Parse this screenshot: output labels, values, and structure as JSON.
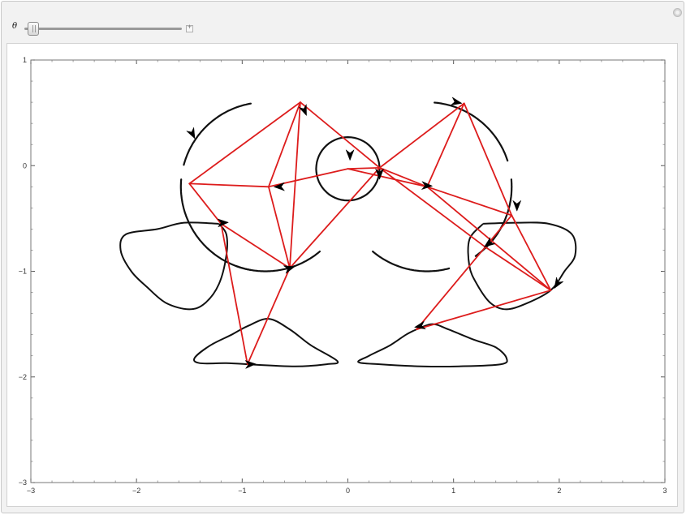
{
  "controls": {
    "parameter_label": "θ",
    "slider_value_fraction": 0.02
  },
  "chart_data": {
    "type": "line",
    "xlim": [
      -3,
      3
    ],
    "ylim": [
      -3,
      1
    ],
    "x_tick_labels": [
      "−3",
      "−2",
      "−1",
      "0",
      "1",
      "2",
      "3"
    ],
    "x_ticks": [
      -3,
      -2,
      -1,
      0,
      1,
      2,
      3
    ],
    "y_tick_labels": [
      "1",
      "0",
      "−1",
      "−2",
      "−3"
    ],
    "y_ticks": [
      1,
      0,
      -1,
      -2,
      -3
    ],
    "grid": false,
    "colors": {
      "curves": "#111111",
      "links": "#dd1c1c",
      "frame": "#777777"
    },
    "points": [
      {
        "id": "C",
        "x": 0.0,
        "y": -0.03
      },
      {
        "id": "C2",
        "x": 0.3,
        "y": -0.02
      },
      {
        "id": "L1",
        "x": -1.5,
        "y": -0.17
      },
      {
        "id": "L2",
        "x": -0.45,
        "y": 0.6
      },
      {
        "id": "L3",
        "x": -0.75,
        "y": -0.2
      },
      {
        "id": "L4",
        "x": -1.2,
        "y": -0.55
      },
      {
        "id": "L5",
        "x": -0.55,
        "y": -0.97
      },
      {
        "id": "L6",
        "x": -0.95,
        "y": -1.88
      },
      {
        "id": "R1",
        "x": 1.1,
        "y": 0.59
      },
      {
        "id": "R2",
        "x": 0.75,
        "y": -0.2
      },
      {
        "id": "R3",
        "x": 1.55,
        "y": -0.47
      },
      {
        "id": "R4",
        "x": 1.3,
        "y": -0.77
      },
      {
        "id": "R5",
        "x": 1.92,
        "y": -1.18
      },
      {
        "id": "R6",
        "x": 0.65,
        "y": -1.55
      }
    ],
    "links": [
      [
        "L1",
        "L2"
      ],
      [
        "L1",
        "L3"
      ],
      [
        "L1",
        "L4"
      ],
      [
        "L2",
        "L3"
      ],
      [
        "L2",
        "L5"
      ],
      [
        "L2",
        "C2"
      ],
      [
        "L3",
        "L5"
      ],
      [
        "L3",
        "C"
      ],
      [
        "L4",
        "L5"
      ],
      [
        "L4",
        "L6"
      ],
      [
        "L5",
        "L6"
      ],
      [
        "L5",
        "C2"
      ],
      [
        "C",
        "C2"
      ],
      [
        "C",
        "R2"
      ],
      [
        "C2",
        "R1"
      ],
      [
        "C2",
        "R2"
      ],
      [
        "C2",
        "R4"
      ],
      [
        "R1",
        "R2"
      ],
      [
        "R1",
        "R3"
      ],
      [
        "R2",
        "R3"
      ],
      [
        "R2",
        "R5"
      ],
      [
        "R3",
        "R4"
      ],
      [
        "R3",
        "R5"
      ],
      [
        "R4",
        "R5"
      ],
      [
        "R4",
        "R6"
      ],
      [
        "R5",
        "R6"
      ]
    ],
    "arcs": [
      {
        "cx": -0.78,
        "cy": -0.2,
        "r": 0.8,
        "from": 100,
        "to": 165
      },
      {
        "cx": -0.78,
        "cy": -0.2,
        "r": 0.8,
        "from": 175,
        "to": 260
      },
      {
        "cx": -0.78,
        "cy": -0.2,
        "r": 0.8,
        "from": 250,
        "to": 310
      },
      {
        "cx": 0.75,
        "cy": -0.2,
        "r": 0.8,
        "from": 18,
        "to": 85
      },
      {
        "cx": 0.75,
        "cy": -0.2,
        "r": 0.8,
        "from": -55,
        "to": 5
      },
      {
        "cx": 0.75,
        "cy": -0.2,
        "r": 0.8,
        "from": 230,
        "to": 285
      },
      {
        "cx": 0.0,
        "cy": -0.03,
        "r": 0.3,
        "from": 0,
        "to": 360
      }
    ],
    "closed_curves": [
      [
        [
          -1.22,
          -0.55
        ],
        [
          -1.55,
          -0.54
        ],
        [
          -1.8,
          -0.6
        ],
        [
          -2.1,
          -0.65
        ],
        [
          -2.15,
          -0.8
        ],
        [
          -2.05,
          -1.0
        ],
        [
          -1.9,
          -1.15
        ],
        [
          -1.72,
          -1.3
        ],
        [
          -1.5,
          -1.36
        ],
        [
          -1.35,
          -1.3
        ],
        [
          -1.22,
          -1.12
        ],
        [
          -1.15,
          -0.85
        ],
        [
          -1.15,
          -0.65
        ],
        [
          -1.22,
          -0.55
        ]
      ],
      [
        [
          1.28,
          -0.55
        ],
        [
          1.6,
          -0.54
        ],
        [
          1.9,
          -0.55
        ],
        [
          2.12,
          -0.65
        ],
        [
          2.15,
          -0.85
        ],
        [
          2.05,
          -1.0
        ],
        [
          1.92,
          -1.18
        ],
        [
          1.7,
          -1.3
        ],
        [
          1.5,
          -1.36
        ],
        [
          1.35,
          -1.3
        ],
        [
          1.22,
          -1.12
        ],
        [
          1.15,
          -0.95
        ],
        [
          1.15,
          -0.7
        ],
        [
          1.28,
          -0.55
        ]
      ],
      [
        [
          -0.95,
          -1.88
        ],
        [
          -1.15,
          -1.87
        ],
        [
          -1.4,
          -1.87
        ],
        [
          -1.45,
          -1.82
        ],
        [
          -1.3,
          -1.7
        ],
        [
          -1.1,
          -1.6
        ],
        [
          -0.95,
          -1.52
        ],
        [
          -0.75,
          -1.45
        ],
        [
          -0.55,
          -1.55
        ],
        [
          -0.35,
          -1.7
        ],
        [
          -0.1,
          -1.85
        ],
        [
          -0.2,
          -1.88
        ],
        [
          -0.5,
          -1.9
        ],
        [
          -0.95,
          -1.88
        ]
      ],
      [
        [
          0.65,
          -1.55
        ],
        [
          0.55,
          -1.6
        ],
        [
          0.4,
          -1.7
        ],
        [
          0.2,
          -1.8
        ],
        [
          0.1,
          -1.86
        ],
        [
          0.3,
          -1.88
        ],
        [
          0.7,
          -1.9
        ],
        [
          1.05,
          -1.9
        ],
        [
          1.45,
          -1.88
        ],
        [
          1.5,
          -1.82
        ],
        [
          1.4,
          -1.72
        ],
        [
          1.2,
          -1.65
        ],
        [
          0.95,
          -1.55
        ],
        [
          0.8,
          -1.5
        ],
        [
          0.65,
          -1.55
        ]
      ]
    ],
    "arrows": [
      {
        "x": -1.47,
        "y": 0.3,
        "dir": [
          0.5,
          -1
        ]
      },
      {
        "x": -0.41,
        "y": 0.52,
        "dir": [
          0.4,
          -1
        ]
      },
      {
        "x": -1.18,
        "y": -0.54,
        "dir": [
          1,
          0.05
        ]
      },
      {
        "x": -0.55,
        "y": -0.97,
        "dir": [
          1,
          0.3
        ]
      },
      {
        "x": -0.92,
        "y": -1.88,
        "dir": [
          1,
          0.05
        ]
      },
      {
        "x": 0.02,
        "y": 0.1,
        "dir": [
          0,
          -1
        ]
      },
      {
        "x": -0.65,
        "y": -0.2,
        "dir": [
          -1,
          -0.02
        ]
      },
      {
        "x": 0.3,
        "y": -0.08,
        "dir": [
          0,
          -1
        ]
      },
      {
        "x": 0.75,
        "y": -0.19,
        "dir": [
          1,
          -0.05
        ]
      },
      {
        "x": 1.03,
        "y": 0.6,
        "dir": [
          1,
          -0.2
        ]
      },
      {
        "x": 1.6,
        "y": -0.38,
        "dir": [
          0,
          -1
        ]
      },
      {
        "x": 1.33,
        "y": -0.74,
        "dir": [
          -0.8,
          -0.6
        ]
      },
      {
        "x": 1.98,
        "y": -1.12,
        "dir": [
          -0.5,
          -0.8
        ]
      },
      {
        "x": 0.68,
        "y": -1.52,
        "dir": [
          -1,
          -0.2
        ]
      }
    ]
  }
}
